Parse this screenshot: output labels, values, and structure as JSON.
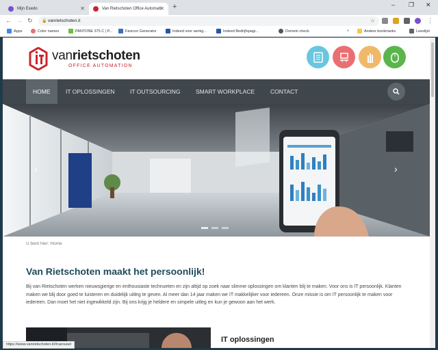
{
  "browser": {
    "tabs": [
      {
        "title": "Mijn Exedo",
        "favicon_color": "#7b4fcf",
        "close": "✕"
      },
      {
        "title": "Van Rietschoten Office Automati",
        "favicon_color": "#c9252c",
        "close": "✕"
      }
    ],
    "new_tab": "+",
    "window_controls": [
      "–",
      "❐",
      "✕"
    ],
    "url": "vanrietschoten.it",
    "bookmarks": [
      {
        "label": "Apps",
        "icon": "apps-grid-icon",
        "color": "#4285f4"
      },
      {
        "label": "Color names",
        "icon": "color-wheel-icon",
        "color": "#e57373"
      },
      {
        "label": "PANTONE 375 C | P...",
        "icon": "pantone-icon",
        "color": "#6cbf3a"
      },
      {
        "label": "Favicon Generator",
        "icon": "favicon-icon",
        "color": "#3b6fb6"
      },
      {
        "label": "Indeed voor werkg...",
        "icon": "indeed-icon",
        "color": "#2557a7"
      },
      {
        "label": "Indeed Bedrijfspagi...",
        "icon": "indeed-icon",
        "color": "#2557a7"
      },
      {
        "label": "Domein check",
        "icon": "globe-icon",
        "color": "#555555"
      }
    ],
    "more_bookmarks": "»",
    "other_bookmarks": "Andere bookmarks",
    "reading_list": "Leeslijst",
    "status_url": "https://www.vanrietschoten.it/#carousel"
  },
  "site": {
    "logo": {
      "word_light": "van",
      "word_bold": "rietschoten",
      "subtitle": "OFFICE AUTOMATION",
      "accent": "#c9252c"
    },
    "service_icons": [
      {
        "name": "document-icon",
        "color": "#69c6e0"
      },
      {
        "name": "workplace-icon",
        "color": "#ea6f72"
      },
      {
        "name": "hand-icon",
        "color": "#f0b96a"
      },
      {
        "name": "mouse-icon",
        "color": "#5bb54c"
      }
    ],
    "nav": [
      "HOME",
      "IT OPLOSSINGEN",
      "IT OUTSOURCING",
      "SMART WORKPLACE",
      "CONTACT"
    ],
    "breadcrumb": "U bent hier: Home",
    "heading": "Van Rietschoten maakt het persoonlijk!",
    "intro": "Bij van Rietschoten werken nieuwsgierige en enthousiaste technueten en zijn altijd op zoek naar slimme oplossingen om klanten blij te maken. Voor ons is IT persoonlijk. Klanten maken we blij door goed te luisteren en duidelijk uitleg te geven. Al meer dan 14 jaar maken we IT makkelijker voor iedereen. Onze missie is om IT persoonlijk te maken voor iedereen. Dan moet het niet ingewikkeld zijn. Bij ons krijg je heldere en simpele uitleg en kun je gewoon aan het werk.",
    "section_title": "IT oplossingen"
  }
}
